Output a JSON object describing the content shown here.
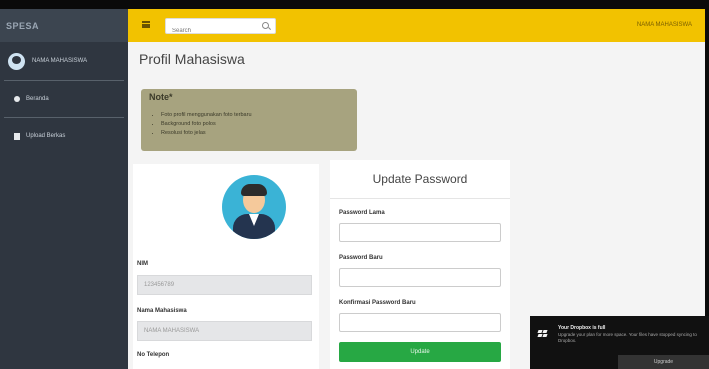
{
  "sidebar": {
    "brand": "SPESA",
    "user_name": "NAMA MAHASISWA",
    "items": [
      {
        "label": "Beranda"
      },
      {
        "label": "Upload Berkas"
      }
    ]
  },
  "topbar": {
    "search_placeholder": "Search",
    "user_name": "NAMA MAHASISWA"
  },
  "page": {
    "title": "Profil Mahasiswa"
  },
  "note": {
    "title": "Note*",
    "items": [
      "Foto profil menggunakan foto terbaru",
      "Background foto polos",
      "Resolusi foto jelas"
    ]
  },
  "profile": {
    "fields": [
      {
        "label": "NIM",
        "value": "123456789"
      },
      {
        "label": "Nama Mahasiswa",
        "value": "NAMA MAHASISWA"
      },
      {
        "label": "No Telepon",
        "value": ""
      }
    ]
  },
  "password_card": {
    "title": "Update Password",
    "fields": [
      {
        "label": "Password Lama"
      },
      {
        "label": "Password Baru"
      },
      {
        "label": "Konfirmasi Password Baru"
      }
    ],
    "button": "Update"
  },
  "toast": {
    "title": "Your Dropbox is full",
    "body": "Upgrade your plan for more space. Your files have stopped syncing to Dropbox.",
    "button": "Upgrade"
  },
  "colors": {
    "sidebar": "#2f3640",
    "topbar": "#f2c200",
    "note": "#a7a37f",
    "button": "#27a844"
  }
}
